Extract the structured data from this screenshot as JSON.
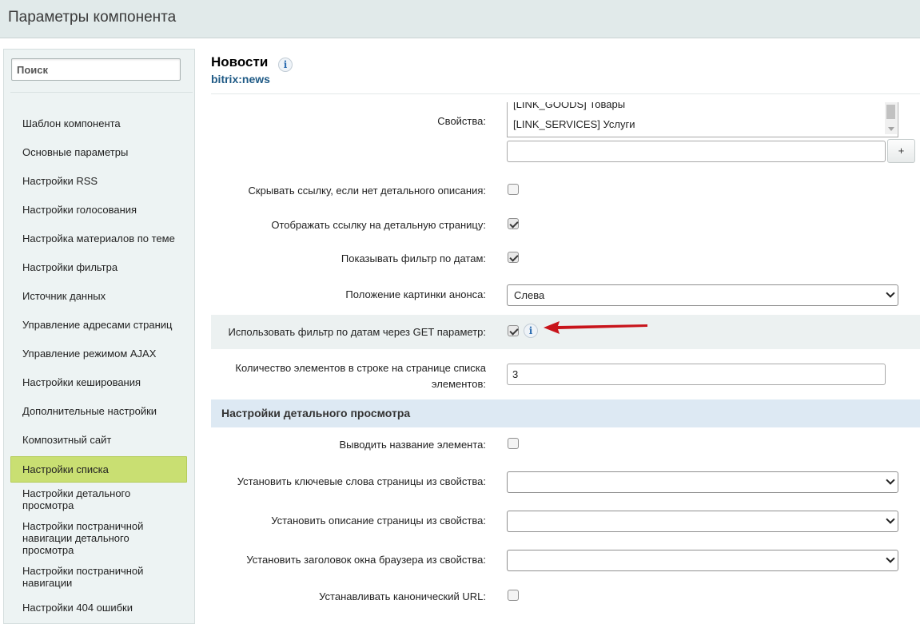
{
  "window": {
    "title": "Параметры компонента"
  },
  "sidebar": {
    "search_placeholder": "Поиск",
    "items": [
      {
        "label": "Шаблон компонента"
      },
      {
        "label": "Основные параметры"
      },
      {
        "label": "Настройки RSS"
      },
      {
        "label": "Настройки голосования"
      },
      {
        "label": "Настройка материалов по теме"
      },
      {
        "label": "Настройки фильтра"
      },
      {
        "label": "Источник данных"
      },
      {
        "label": "Управление адресами страниц"
      },
      {
        "label": "Управление режимом AJAX"
      },
      {
        "label": "Настройки кеширования"
      },
      {
        "label": "Дополнительные настройки"
      },
      {
        "label": "Композитный сайт"
      },
      {
        "label": "Настройки списка",
        "active": true
      },
      {
        "label": "Настройки детального просмотра"
      },
      {
        "label": "Настройки постраничной навигации детального просмотра"
      },
      {
        "label": "Настройки постраничной навигации"
      },
      {
        "label": "Настройки 404 ошибки"
      }
    ]
  },
  "component": {
    "title": "Новости",
    "info_glyph": "i",
    "code": "bitrix:news"
  },
  "params": {
    "properties_label": "Свойства:",
    "properties_options": [
      "[LINK_GOODS] Товары",
      "[LINK_SERVICES] Услуги"
    ],
    "add_label": "+",
    "hide_link_label": "Скрывать ссылку, если нет детального описания:",
    "hide_link_checked": false,
    "show_detail_link_label": "Отображать ссылку на детальную страницу:",
    "show_detail_link_checked": true,
    "show_date_filter_label": "Показывать фильтр по датам:",
    "show_date_filter_checked": true,
    "preview_picture_position_label": "Положение картинки анонса:",
    "preview_picture_position_value": "Слева",
    "use_date_filter_get_label": "Использовать фильтр по датам через GET параметр:",
    "use_date_filter_get_checked": true,
    "items_per_row_label": "Количество элементов в строке на странице списка элементов:",
    "items_per_row_value": "3"
  },
  "detail_section": {
    "title": "Настройки детального просмотра",
    "show_element_name_label": "Выводить название элемента:",
    "show_element_name_checked": false,
    "meta_keywords_label": "Установить ключевые слова страницы из свойства:",
    "meta_keywords_value": "",
    "meta_description_label": "Установить описание страницы из свойства:",
    "meta_description_value": "",
    "browser_title_label": "Установить заголовок окна браузера из свойства:",
    "browser_title_value": "",
    "canonical_url_label": "Устанавливать канонический URL:",
    "canonical_url_checked": false
  },
  "colors": {
    "titlebar_bg": "#e1eaea",
    "sidebar_bg": "#edf3f3",
    "active_item_bg": "#c9df72",
    "section_head_bg": "#dde9f3",
    "component_code": "#1f5a85",
    "arrow": "#c8141b"
  }
}
